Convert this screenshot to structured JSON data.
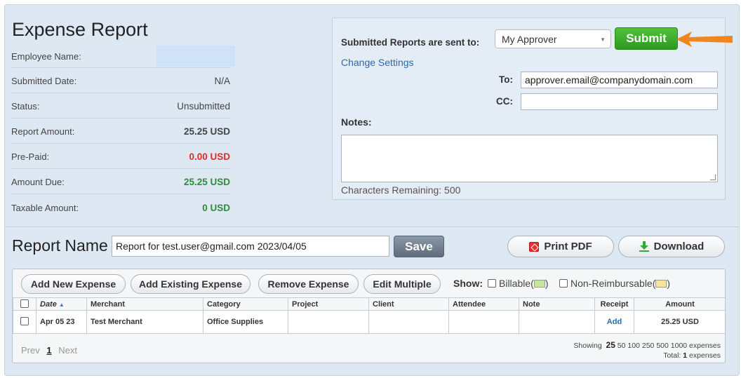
{
  "report": {
    "title": "Expense Report",
    "fields": [
      {
        "label": "Employee Name:",
        "value": ""
      },
      {
        "label": "Submitted Date:",
        "value": "N/A"
      },
      {
        "label": "Status:",
        "value": "Unsubmitted"
      },
      {
        "label": "Report Amount:",
        "value": "25.25 USD"
      },
      {
        "label": "Pre-Paid:",
        "value": "0.00 USD"
      },
      {
        "label": "Amount Due:",
        "value": "25.25 USD"
      },
      {
        "label": "Taxable Amount:",
        "value": "0 USD"
      }
    ],
    "colors": {
      "prepaid": "#e02b2b",
      "due": "#2e8b3a",
      "name_box": "#cfe2f8"
    }
  },
  "submit_panel": {
    "sent_label": "Submitted Reports are sent to:",
    "approver_selected": "My Approver",
    "submit_label": "Submit",
    "change_settings": "Change Settings",
    "to_label": "To:",
    "to_value": "approver.email@companydomain.com",
    "cc_label": "CC:",
    "cc_value": "",
    "notes_label": "Notes:",
    "chars_remaining": "Characters Remaining: 500",
    "submit_color": "#3aab2c",
    "arrow_color": "#f0861f"
  },
  "report_name": {
    "label": "Report Name",
    "value": "Report for test.user@gmail.com 2023/04/05",
    "save_label": "Save",
    "print_pdf_label": "Print PDF",
    "download_label": "Download"
  },
  "toolbar": {
    "add_new": "Add New Expense",
    "add_existing": "Add Existing Expense",
    "remove": "Remove Expense",
    "edit_multiple": "Edit Multiple",
    "show_label": "Show:",
    "billable": "Billable(",
    "non_reimbursable": "Non-Reimbursable(",
    "close_paren": ")",
    "billable_color": "#c8e6a0",
    "nonreimb_color": "#f7e2a0"
  },
  "table": {
    "headers": [
      "Date",
      "Merchant",
      "Category",
      "Project",
      "Client",
      "Attendee",
      "Note",
      "Receipt",
      "Amount"
    ],
    "sort_indicator": "▲",
    "rows": [
      {
        "date": "Apr 05 23",
        "merchant": "Test Merchant",
        "category": "Office Supplies",
        "project": "",
        "client": "",
        "attendee": "",
        "note": "",
        "receipt": "Add",
        "amount": "25.25 USD"
      }
    ]
  },
  "pager": {
    "prev": "Prev",
    "current": "1",
    "next": "Next",
    "showing": "Showing",
    "page_sizes": [
      "25",
      "50",
      "100",
      "250",
      "500",
      "1000"
    ],
    "expenses_word": "expenses",
    "total_label": "Total:",
    "total_count": "1",
    "total_suffix": "expenses"
  }
}
